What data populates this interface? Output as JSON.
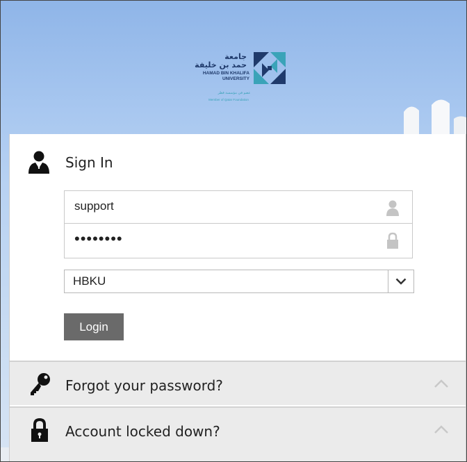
{
  "logo": {
    "arabic_line1": "جامعة",
    "arabic_line2": "حمد بن خليفة",
    "english_line1": "HAMAD BIN KHALIFA",
    "english_line2": "UNIVERSITY",
    "arabic_member": "عضو في مؤسسة قطر",
    "member_text": "Member of Qatar Foundation"
  },
  "signin": {
    "title": "Sign In",
    "username_value": "support",
    "password_value": "••••••••",
    "domain_value": "HBKU",
    "login_label": "Login"
  },
  "accordion": {
    "forgot_label": "Forgot your password?",
    "locked_label": "Account locked down?"
  },
  "icons": {
    "user": "user-silhouette-icon",
    "field_user": "user-icon",
    "lock": "lock-icon",
    "dropdown": "chevron-down-icon",
    "key": "key-icon",
    "padlock": "padlock-icon",
    "collapse": "chevron-up-icon"
  },
  "colors": {
    "login_button": "#6a6a6a",
    "accordion_bg": "#ebebeb",
    "sky": "#a9c8f0",
    "logo_navy": "#1f3a6b",
    "logo_teal": "#3aa3b8"
  }
}
